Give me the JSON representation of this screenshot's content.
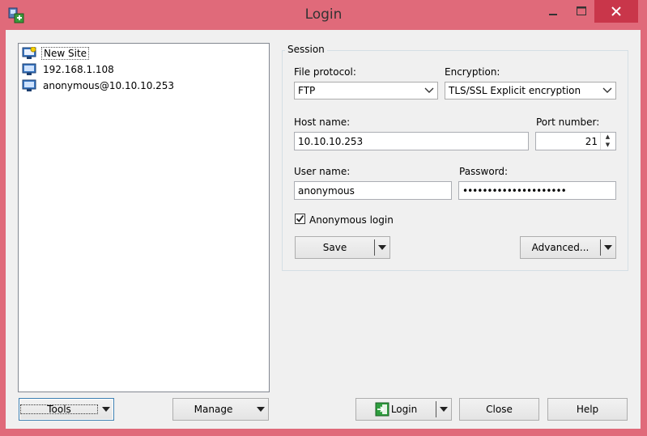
{
  "window": {
    "title": "Login"
  },
  "sites": [
    {
      "label": "New Site",
      "icon": "new-site-icon"
    },
    {
      "label": "192.168.1.108",
      "icon": "computer-icon"
    },
    {
      "label": "anonymous@10.10.10.253",
      "icon": "computer-icon"
    }
  ],
  "session": {
    "legend": "Session",
    "file_protocol_label": "File protocol:",
    "file_protocol_value": "FTP",
    "encryption_label": "Encryption:",
    "encryption_value": "TLS/SSL Explicit encryption",
    "host_label": "Host name:",
    "host_value": "10.10.10.253",
    "port_label": "Port number:",
    "port_value": "21",
    "user_label": "User name:",
    "user_value": "anonymous",
    "password_label": "Password:",
    "password_value": "•••••••••••••••••••••",
    "anonymous_label": "Anonymous login",
    "anonymous_checked": true,
    "save_label": "Save",
    "advanced_label": "Advanced..."
  },
  "bottom": {
    "tools_label": "Tools",
    "manage_label": "Manage",
    "login_label": "Login",
    "close_label": "Close",
    "help_label": "Help"
  },
  "colors": {
    "titlebar": "#e06a7a",
    "close_button": "#c9364a",
    "dialog": "#f0f0f0",
    "login_icon": "#2e9e3e"
  }
}
